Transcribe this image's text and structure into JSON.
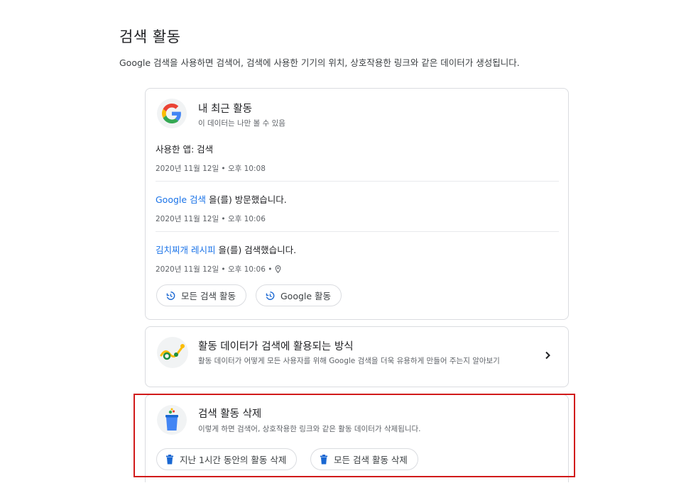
{
  "page": {
    "title": "검색 활동",
    "description": "Google 검색을 사용하면 검색어, 검색에 사용한 기기의 위치, 상호작용한 링크와 같은 데이터가 생성됩니다."
  },
  "recent": {
    "title": "내 최근 활동",
    "subtitle": "이 데이터는 나만 볼 수 있음",
    "entries": [
      {
        "prefix": "사용한 앱: 검색",
        "link": "",
        "suffix": "",
        "meta": "2020년 11월 12일 • 오후 10:08",
        "has_location": false
      },
      {
        "prefix": "",
        "link": "Google 검색",
        "suffix": " 을(를) 방문했습니다.",
        "meta": "2020년 11월 12일 • 오후 10:06",
        "has_location": false
      },
      {
        "prefix": "",
        "link": "김치찌개 레시피",
        "suffix": " 을(를) 검색했습니다.",
        "meta": "2020년 11월 12일 • 오후 10:06 •",
        "has_location": true
      }
    ],
    "buttons": {
      "all_search": "모든 검색 활동",
      "google_activity": "Google 활동"
    }
  },
  "info": {
    "title": "활동 데이터가 검색에 활용되는 방식",
    "description": "활동 데이터가 어떻게 모든 사용자를 위해 Google 검색을 더욱 유용하게 만들어 주는지 알아보기"
  },
  "delete": {
    "title": "검색 활동 삭제",
    "description": "이렇게 하면 검색어, 상호작용한 링크와 같은 활동 데이터가 삭제됩니다.",
    "buttons": {
      "last_hour": "지난 1시간 동안의 활동 삭제",
      "all": "모든 검색 활동 삭제"
    }
  },
  "colors": {
    "link": "#1a73e8",
    "highlight": "#d11a1a",
    "icon_blue": "#1967d2"
  },
  "icons": [
    "google-logo-icon",
    "history-icon",
    "location-pin-icon",
    "activity-insight-icon",
    "chevron-right-icon",
    "trash-icon"
  ]
}
